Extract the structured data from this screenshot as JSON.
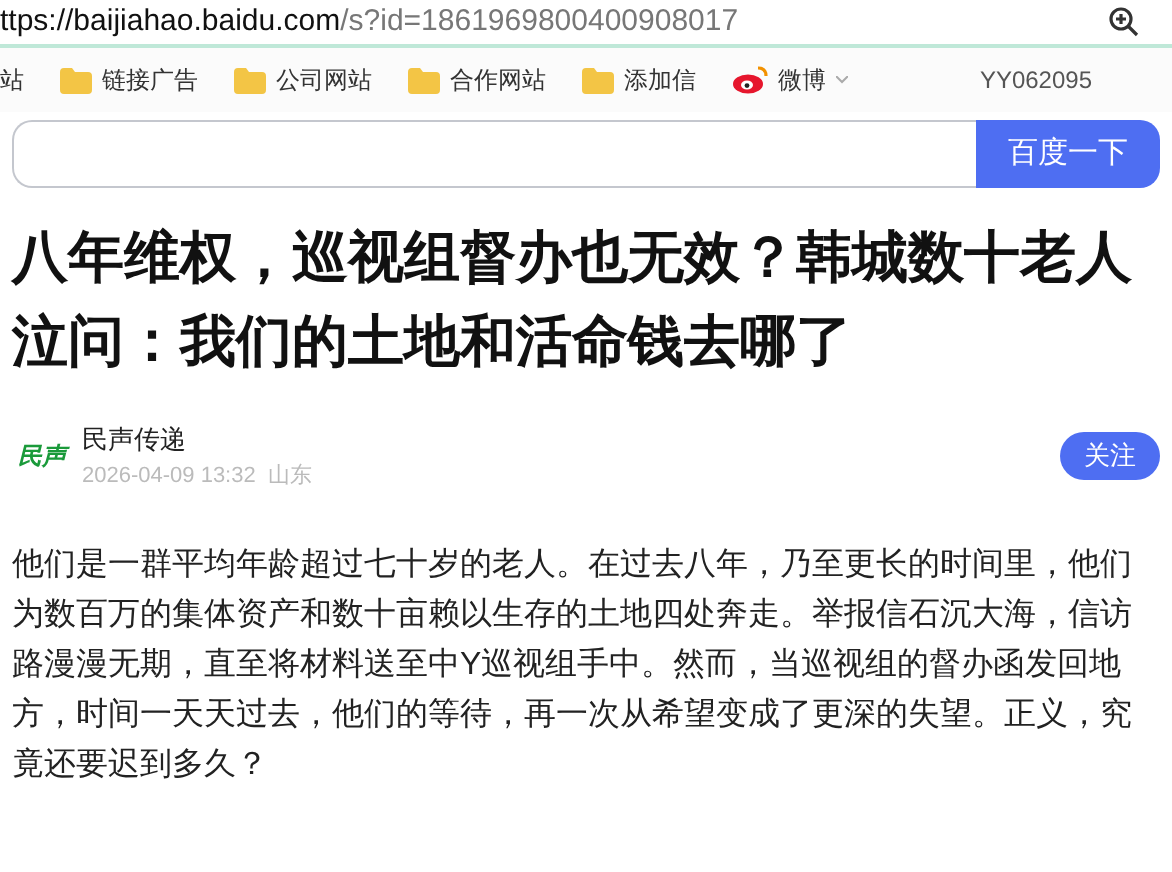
{
  "address_bar": {
    "url_host": "ttps://baijiahao.baidu.com",
    "url_path": "/s?id=1861969800400908017"
  },
  "bookmarks": [
    {
      "label": "站",
      "kind": "plain"
    },
    {
      "label": "链接广告",
      "kind": "folder"
    },
    {
      "label": "公司网站",
      "kind": "folder"
    },
    {
      "label": "合作网站",
      "kind": "folder"
    },
    {
      "label": "添加信",
      "kind": "folder"
    },
    {
      "label": "微博",
      "kind": "weibo"
    }
  ],
  "user_id": "YY062095",
  "search": {
    "button": "百度一下"
  },
  "article": {
    "title": "八年维权，巡视组督办也无效？韩城数十老人泣问：我们的土地和活命钱去哪了",
    "author": {
      "logo": "民声",
      "name": "民声传递",
      "date": "2026-04-09 13:32",
      "location": "山东",
      "follow": "关注"
    },
    "body": "他们是一群平均年龄超过七十岁的老人。在过去八年，乃至更长的时间里，他们为数百万的集体资产和数十亩赖以生存的土地四处奔走。举报信石沉大海，信访路漫漫无期，直至将材料送至中Y巡视组手中。然而，当巡视组的督办函发回地方，时间一天天过去，他们的等待，再一次从希望变成了更深的失望。正义，究竟还要迟到多久？"
  }
}
